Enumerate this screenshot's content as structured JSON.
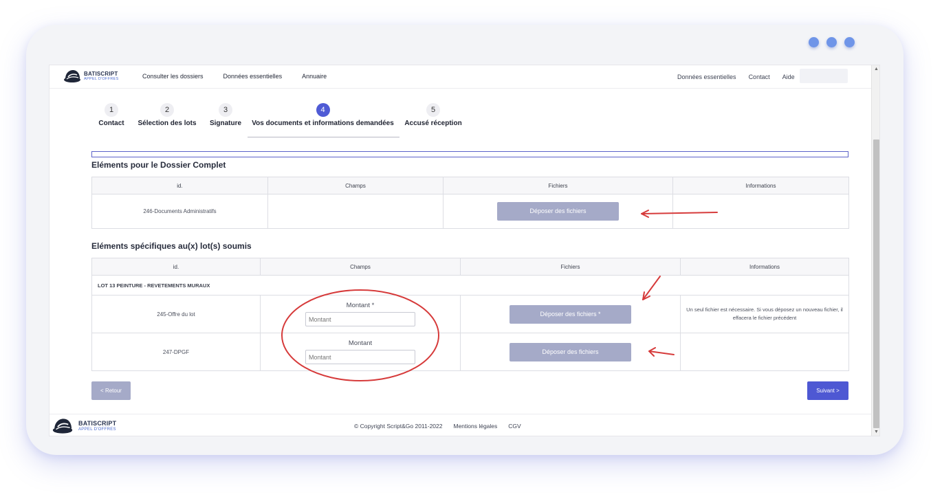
{
  "brand": {
    "name": "BATISCRIPT",
    "sub": "APPEL D'OFFRES"
  },
  "header": {
    "nav": [
      "Consulter les dossiers",
      "Données essentielles",
      "Annuaire"
    ],
    "right_nav": [
      "Données essentielles",
      "Contact",
      "Aide"
    ]
  },
  "steps": [
    {
      "num": "1",
      "label": "Contact"
    },
    {
      "num": "2",
      "label": "Sélection des lots"
    },
    {
      "num": "3",
      "label": "Signature"
    },
    {
      "num": "4",
      "label": "Vos documents et informations demandées"
    },
    {
      "num": "5",
      "label": "Accusé réception"
    }
  ],
  "active_step": 4,
  "progress": 0,
  "section1": {
    "title": "Eléments pour le Dossier Complet",
    "headers": [
      "id.",
      "Champs",
      "Fichiers",
      "Informations"
    ],
    "row": {
      "id": "246-Documents Administratifs",
      "button": "Déposer des fichiers"
    }
  },
  "section2": {
    "title": "Eléments spécifiques au(x) lot(s) soumis",
    "headers": [
      "id.",
      "Champs",
      "Fichiers",
      "Informations"
    ],
    "lot": "LOT 13 PEINTURE - REVETEMENTS MURAUX",
    "rows": [
      {
        "id": "245-Offre du lot",
        "field_label": "Montant *",
        "placeholder": "Montant",
        "button": "Déposer des fichiers *",
        "info": "Un seul fichier est nécessaire. Si vous déposez un nouveau fichier, il effacera le fichier précédent"
      },
      {
        "id": "247-DPGF",
        "field_label": "Montant",
        "placeholder": "Montant",
        "button": "Déposer des fichiers",
        "info": ""
      }
    ]
  },
  "buttons": {
    "back": "< Retour",
    "next": "Suivant >"
  },
  "footer": {
    "copyright": "© Copyright Script&Go 2011-2022",
    "links": [
      "Mentions légales",
      "CGV"
    ]
  },
  "colors": {
    "accent": "#4f5bd5",
    "button_disabled": "#a5aac8",
    "annotation": "#d63a3a",
    "window_dots": "#6f95e8"
  }
}
